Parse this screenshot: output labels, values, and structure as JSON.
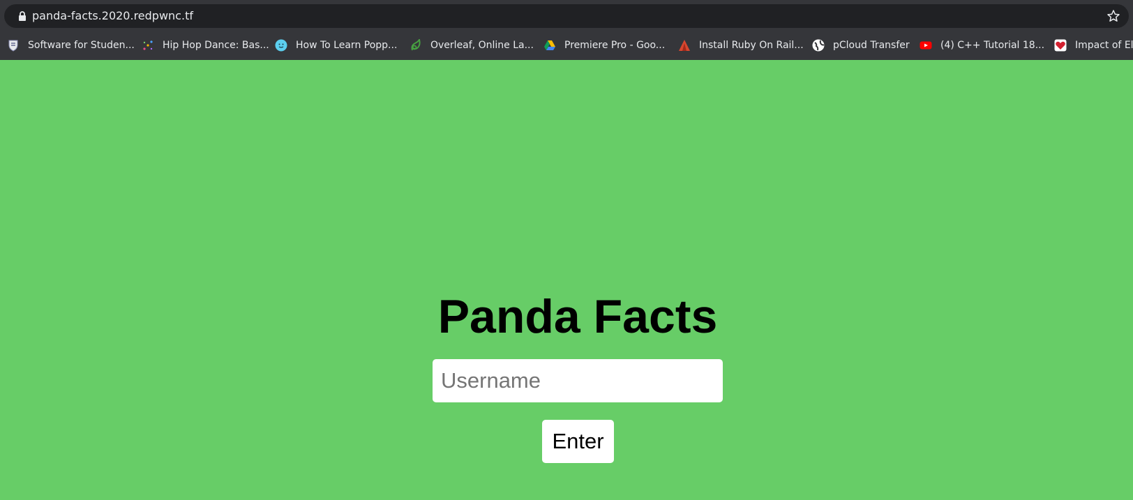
{
  "browser": {
    "url": "panda-facts.2020.redpwnc.tf",
    "bookmarks": [
      {
        "label": "Software for Studen...",
        "icon": "shield-crest-icon"
      },
      {
        "label": "Hip Hop Dance: Bas...",
        "icon": "sparkle-icon"
      },
      {
        "label": "How To Learn Popp...",
        "icon": "smiley-icon"
      },
      {
        "label": "Overleaf, Online La...",
        "icon": "leaf-icon"
      },
      {
        "label": "Premiere Pro - Goo...",
        "icon": "drive-icon"
      },
      {
        "label": "Install Ruby On Rail...",
        "icon": "triangle-logo-icon"
      },
      {
        "label": "pCloud Transfer",
        "icon": "globe-icon"
      },
      {
        "label": "(4) C++ Tutorial 18...",
        "icon": "youtube-icon"
      },
      {
        "label": "Impact of Ele",
        "icon": "heart-icon"
      }
    ]
  },
  "page": {
    "title": "Panda Facts",
    "username_placeholder": "Username",
    "username_value": "",
    "enter_label": "Enter",
    "background_color": "#67cd67"
  }
}
